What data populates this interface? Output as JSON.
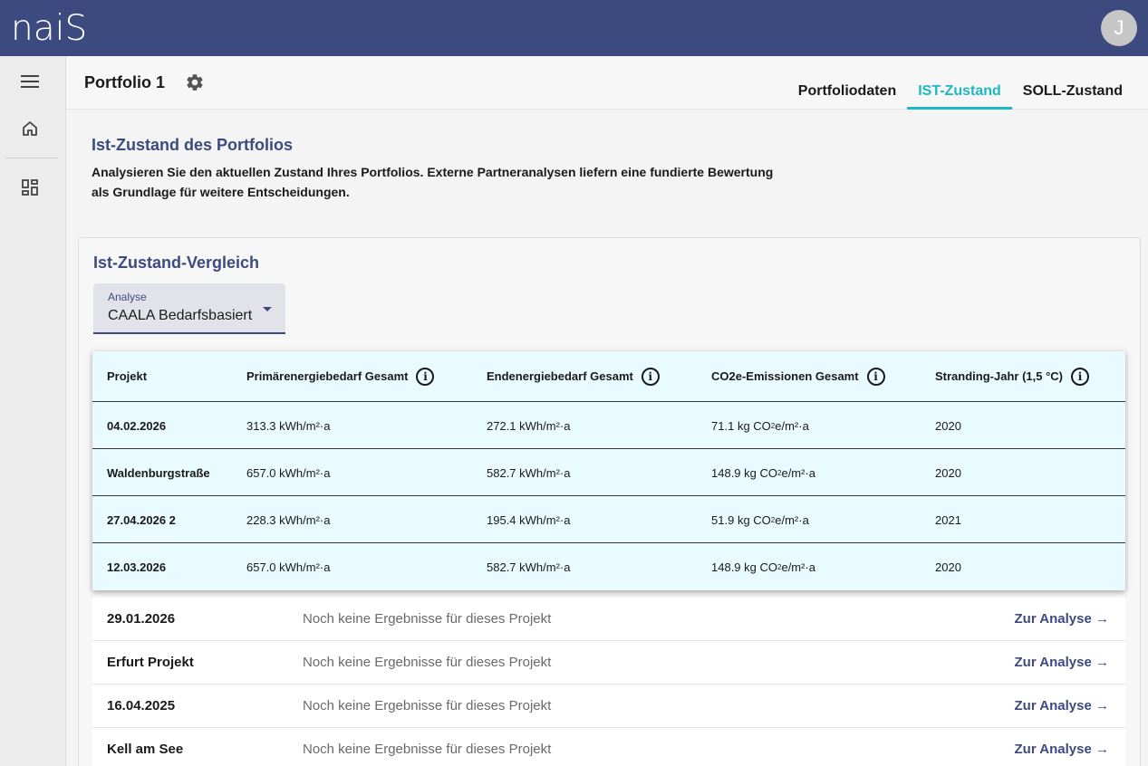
{
  "app": {
    "logo": "naiS",
    "avatar_initial": "J"
  },
  "header": {
    "title": "Portfolio 1",
    "tabs": [
      {
        "label": "Portfoliodaten",
        "active": false
      },
      {
        "label": "IST-Zustand",
        "active": true
      },
      {
        "label": "SOLL-Zustand",
        "active": false
      }
    ]
  },
  "intro": {
    "title": "Ist-Zustand des Portfolios",
    "text": "Analysieren Sie den aktuellen Zustand Ihres Portfolios. Externe Partneranalysen liefern eine fundierte Bewertung als Grundlage für weitere Entscheidungen."
  },
  "card": {
    "title": "Ist-Zustand-Vergleich",
    "select": {
      "label": "Analyse",
      "value": "CAALA Bedarfsbasiert"
    }
  },
  "table": {
    "columns": [
      "Projekt",
      "Primärenergiebedarf Gesamt",
      "Endenergiebedarf Gesamt",
      "CO2e-Emissionen Gesamt",
      "Stranding-Jahr (1,5 °C)"
    ],
    "rows": [
      {
        "project": "04.02.2026",
        "primary": "313.3 kWh/m²·a",
        "final": "272.1 kWh/m²·a",
        "co2": "71.1",
        "stranding": "2020"
      },
      {
        "project": "Waldenburgstraße",
        "primary": "657.0 kWh/m²·a",
        "final": "582.7 kWh/m²·a",
        "co2": "148.9",
        "stranding": "2020"
      },
      {
        "project": "27.04.2026 2",
        "primary": "228.3 kWh/m²·a",
        "final": "195.4 kWh/m²·a",
        "co2": "51.9",
        "stranding": "2021"
      },
      {
        "project": "12.03.2026",
        "primary": "657.0 kWh/m²·a",
        "final": "582.7 kWh/m²·a",
        "co2": "148.9",
        "stranding": "2020"
      }
    ],
    "co2_unit_prefix": "kg CO",
    "co2_unit_sub": "2",
    "co2_unit_suffix": "e/m²·a"
  },
  "pending": {
    "message": "Noch keine Ergebnisse für dieses Projekt",
    "link": "Zur Analyse →",
    "rows": [
      "29.01.2026",
      "Erfurt Projekt",
      "16.04.2025",
      "Kell am See"
    ]
  },
  "colors": {
    "brand": "#3d4a80",
    "accent": "#1db8c4",
    "table_bg": "#e9fbfe"
  }
}
